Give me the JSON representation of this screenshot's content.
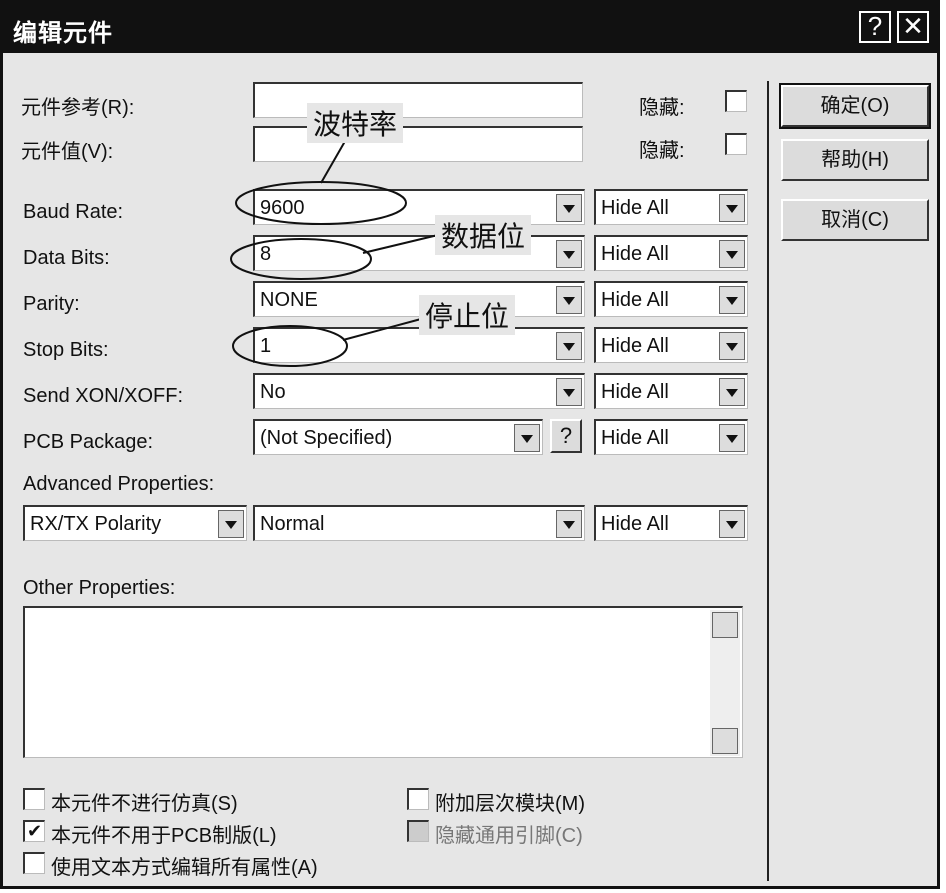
{
  "window": {
    "title": "编辑元件",
    "help_glyph": "?",
    "close_glyph": "✕"
  },
  "fields": {
    "ref_label": "元件参考(R):",
    "ref_value": "",
    "ref_hidden_label": "隐藏:",
    "value_label": "元件值(V):",
    "value_value": "",
    "value_hidden_label": "隐藏:"
  },
  "properties": [
    {
      "label": "Baud Rate:",
      "value": "9600",
      "visibility": "Hide All"
    },
    {
      "label": "Data Bits:",
      "value": "8",
      "visibility": "Hide All"
    },
    {
      "label": "Parity:",
      "value": "NONE",
      "visibility": "Hide All"
    },
    {
      "label": "Stop Bits:",
      "value": "1",
      "visibility": "Hide All"
    },
    {
      "label": "Send XON/XOFF:",
      "value": "No",
      "visibility": "Hide All"
    },
    {
      "label": "PCB Package:",
      "value": "(Not Specified)",
      "visibility": "Hide All"
    }
  ],
  "pcb_help_glyph": "?",
  "advanced": {
    "label": "Advanced Properties:",
    "property": "RX/TX Polarity",
    "value": "Normal",
    "visibility": "Hide All"
  },
  "other": {
    "label": "Other Properties:",
    "text": ""
  },
  "checkboxes": [
    {
      "label": "本元件不进行仿真(S)",
      "checked": false,
      "mark": ""
    },
    {
      "label": "本元件不用于PCB制版(L)",
      "checked": true,
      "mark": "✔"
    },
    {
      "label": "使用文本方式编辑所有属性(A)",
      "checked": false,
      "mark": ""
    },
    {
      "label": "附加层次模块(M)",
      "checked": false,
      "mark": ""
    },
    {
      "label": "隐藏通用引脚(C)",
      "checked": false,
      "disabled": true,
      "mark": ""
    }
  ],
  "buttons": {
    "ok": "确定(O)",
    "help": "帮助(H)",
    "cancel": "取消(C)"
  },
  "annotations": {
    "baud": "波特率",
    "data_bits": "数据位",
    "stop_bits": "停止位"
  }
}
